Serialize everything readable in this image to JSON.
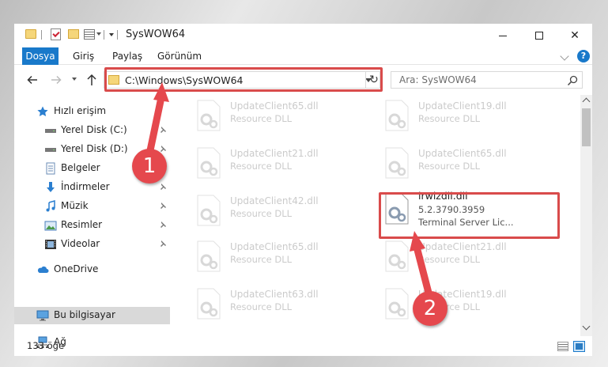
{
  "window": {
    "title": "SysWOW64",
    "minimize_label": "",
    "maximize_label": "",
    "close_label": "✕"
  },
  "ribbon": {
    "tabs": [
      "Dosya",
      "Giriş",
      "Paylaş",
      "Görünüm"
    ],
    "help_label": "?"
  },
  "navigation": {
    "address": "C:\\Windows\\SysWOW64",
    "refresh_label": "↻",
    "search_placeholder": "Ara: SysWOW64"
  },
  "sidebar": {
    "items": [
      {
        "label": "Hızlı erişim",
        "icon": "star-icon",
        "pinned": false
      },
      {
        "label": "Yerel Disk (C:)",
        "icon": "drive-icon",
        "pinned": true
      },
      {
        "label": "Yerel Disk (D:)",
        "icon": "drive-icon",
        "pinned": true
      },
      {
        "label": "Belgeler",
        "icon": "documents-icon",
        "pinned": true
      },
      {
        "label": "İndirmeler",
        "icon": "download-icon",
        "pinned": true
      },
      {
        "label": "Müzik",
        "icon": "music-icon",
        "pinned": true
      },
      {
        "label": "Resimler",
        "icon": "pictures-icon",
        "pinned": true
      },
      {
        "label": "Videolar",
        "icon": "video-icon",
        "pinned": true
      },
      {
        "label": "OneDrive",
        "icon": "cloud-icon",
        "pinned": false
      },
      {
        "label": "Bu bilgisayar",
        "icon": "computer-icon",
        "pinned": false,
        "selected": true
      },
      {
        "label": "Ağ",
        "icon": "network-icon",
        "pinned": false
      }
    ]
  },
  "files": {
    "left": [
      {
        "name": "UpdateClient65.dll",
        "type": "Resource DLL"
      },
      {
        "name": "UpdateClient21.dll",
        "type": "Resource DLL"
      },
      {
        "name": "UpdateClient42.dll",
        "type": "Resource DLL"
      },
      {
        "name": "UpdateClient65.dll",
        "type": "Resource DLL"
      },
      {
        "name": "UpdateClient63.dll",
        "type": "Resource DLL"
      }
    ],
    "right": [
      {
        "name": "UpdateClient19.dll",
        "type": "Resource DLL"
      },
      {
        "name": "UpdateClient65.dll",
        "type": "Resource DLL"
      },
      {
        "name": "lrwizdll.dll",
        "version": "5.2.3790.3959",
        "description": "Terminal Server Lic...",
        "highlighted": true
      },
      {
        "name": "UpdateClient21.dll",
        "type": "Resource DLL"
      },
      {
        "name": "UpdateClient19.dll",
        "type": "Resource DLL"
      }
    ]
  },
  "status": {
    "item_count": "133 öğe"
  },
  "callouts": [
    "1",
    "2"
  ],
  "colors": {
    "accent": "#1979ca",
    "highlight": "#d94b4b",
    "callout": "#e5484d"
  }
}
